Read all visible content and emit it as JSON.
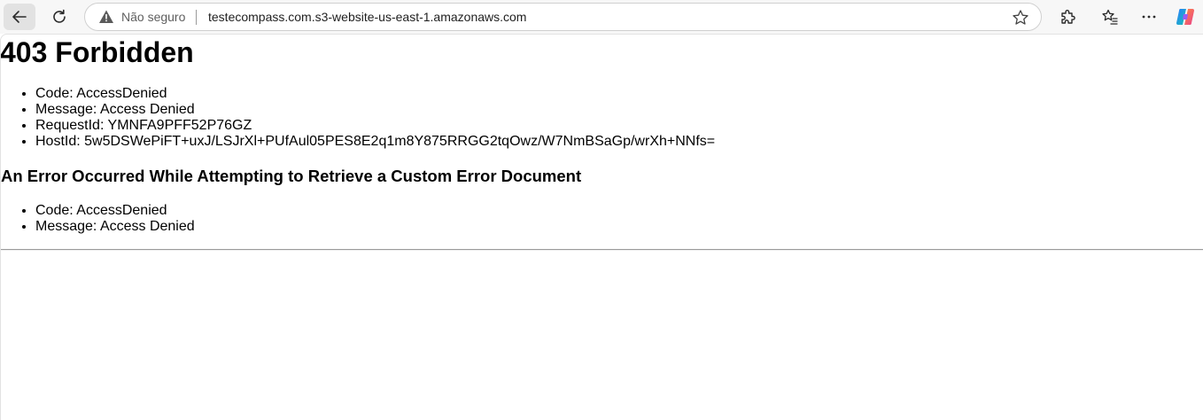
{
  "browser": {
    "security_label": "Não seguro",
    "url": "testecompass.com.s3-website-us-east-1.amazonaws.com",
    "icons": {
      "back": "arrow-left-icon",
      "refresh": "refresh-icon",
      "warning": "warning-triangle-icon",
      "favorite": "star-icon",
      "extensions": "puzzle-icon",
      "favorites_bar": "favorites-list-icon",
      "menu": "more-dots-icon",
      "copilot": "copilot-icon"
    }
  },
  "page": {
    "title": "403 Forbidden",
    "details": [
      {
        "label": "Code:",
        "value": "AccessDenied"
      },
      {
        "label": "Message:",
        "value": "Access Denied"
      },
      {
        "label": "RequestId:",
        "value": "YMNFA9PFF52P76GZ"
      },
      {
        "label": "HostId:",
        "value": "5w5DSWePiFT+uxJ/LSJrXl+PUfAul05PES8E2q1m8Y875RRGG2tqOwz/W7NmBSaGp/wrXh+NNfs="
      }
    ],
    "secondary_heading": "An Error Occurred While Attempting to Retrieve a Custom Error Document",
    "secondary_details": [
      {
        "label": "Code:",
        "value": "AccessDenied"
      },
      {
        "label": "Message:",
        "value": "Access Denied"
      }
    ]
  }
}
